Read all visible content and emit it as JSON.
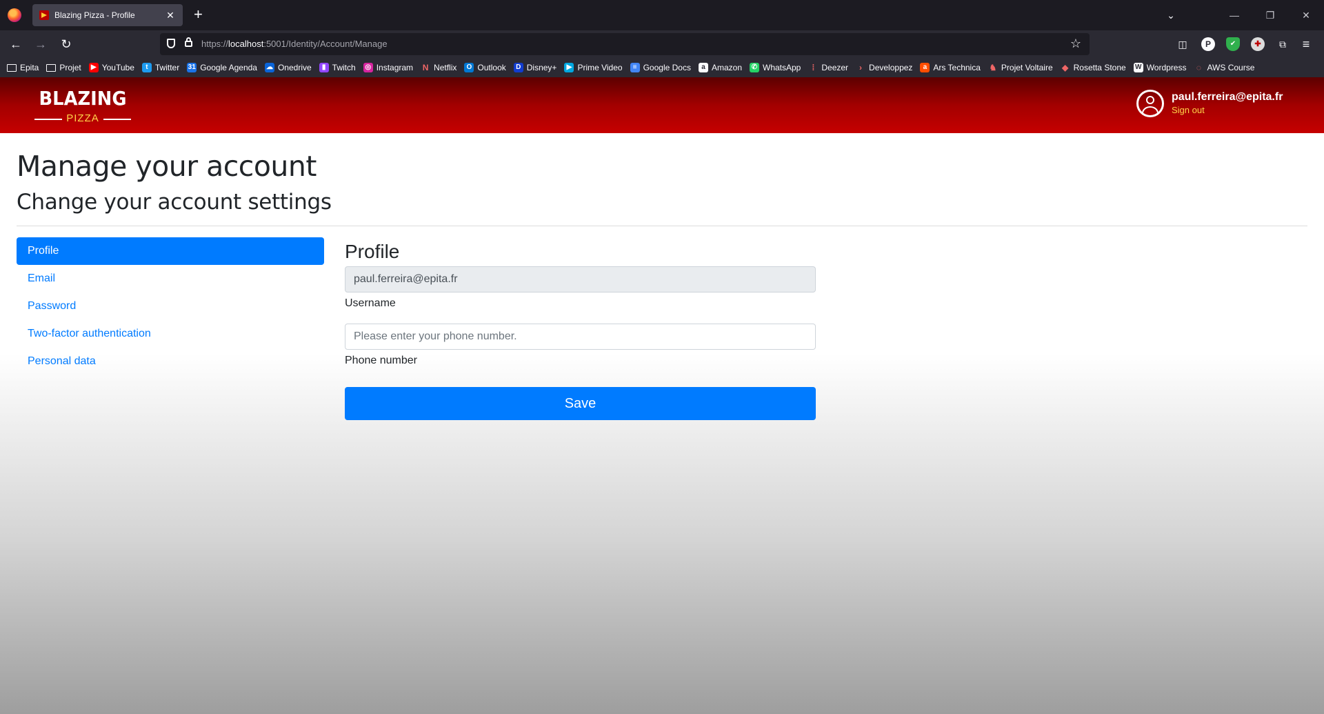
{
  "browser": {
    "tab": {
      "title": "Blazing Pizza - Profile",
      "close": "✕"
    },
    "new_tab": "+",
    "window_controls": {
      "tab_list": "⌄",
      "minimize": "—",
      "restore": "❐",
      "close": "✕"
    },
    "nav": {
      "back": "←",
      "forward": "→",
      "reload": "↻",
      "menu": "≡",
      "star": "☆"
    },
    "url": {
      "scheme": "https://",
      "host": "localhost",
      "rest": ":5001/Identity/Account/Manage"
    },
    "extensions": {
      "pocket": "◫",
      "p": "P",
      "shield": "✔",
      "globe": "✚",
      "puzzle": "⧉"
    },
    "bookmarks": [
      {
        "label": "Epita",
        "icon": "folder-icon"
      },
      {
        "label": "Projet",
        "icon": "folder-icon"
      },
      {
        "label": "YouTube",
        "icon": "youtube-icon",
        "color": "#ff0000",
        "glyph": "▶"
      },
      {
        "label": "Twitter",
        "icon": "twitter-icon",
        "color": "#1d9bf0",
        "glyph": "t"
      },
      {
        "label": "Google Agenda",
        "icon": "google-agenda-icon",
        "color": "#1a73e8",
        "glyph": "31"
      },
      {
        "label": "Onedrive",
        "icon": "onedrive-icon",
        "color": "#0a64d8",
        "glyph": "☁"
      },
      {
        "label": "Twitch",
        "icon": "twitch-icon",
        "color": "#9146ff",
        "glyph": "▮"
      },
      {
        "label": "Instagram",
        "icon": "instagram-icon",
        "color": "#d6249f",
        "glyph": "◎"
      },
      {
        "label": "Netflix",
        "icon": "netflix-icon",
        "color": "#2b2a33",
        "glyph": "N"
      },
      {
        "label": "Outlook",
        "icon": "outlook-icon",
        "color": "#0078d4",
        "glyph": "O"
      },
      {
        "label": "Disney+",
        "icon": "disney-icon",
        "color": "#113ccf",
        "glyph": "D"
      },
      {
        "label": "Prime Video",
        "icon": "prime-video-icon",
        "color": "#00a8e1",
        "glyph": "▶"
      },
      {
        "label": "Google Docs",
        "icon": "google-docs-icon",
        "color": "#4285f4",
        "glyph": "≡"
      },
      {
        "label": "Amazon",
        "icon": "amazon-icon",
        "color": "#fbfbfe",
        "glyph": "a"
      },
      {
        "label": "WhatsApp",
        "icon": "whatsapp-icon",
        "color": "#25d366",
        "glyph": "✆"
      },
      {
        "label": "Deezer",
        "icon": "deezer-icon",
        "color": "#2b2a33",
        "glyph": "⁞"
      },
      {
        "label": "Developpez",
        "icon": "developpez-icon",
        "color": "#2b2a33",
        "glyph": "›"
      },
      {
        "label": "Ars Technica",
        "icon": "ars-technica-icon",
        "color": "#ff4e00",
        "glyph": "a"
      },
      {
        "label": "Projet Voltaire",
        "icon": "projet-voltaire-icon",
        "color": "#2b2a33",
        "glyph": "♞"
      },
      {
        "label": "Rosetta Stone",
        "icon": "rosetta-stone-icon",
        "color": "#2b2a33",
        "glyph": "◆"
      },
      {
        "label": "Wordpress",
        "icon": "wordpress-icon",
        "color": "#fbfbfe",
        "glyph": "W"
      },
      {
        "label": "AWS Course",
        "icon": "aws-icon",
        "color": "#2b2a33",
        "glyph": "◌"
      }
    ]
  },
  "header": {
    "logo_main": "BLAZING",
    "logo_sub": "PIZZA",
    "user_email": "paul.ferreira@epita.fr",
    "sign_out": "Sign out"
  },
  "page": {
    "title": "Manage your account",
    "subtitle": "Change your account settings"
  },
  "sidebar": {
    "items": [
      {
        "label": "Profile",
        "active": true
      },
      {
        "label": "Email",
        "active": false
      },
      {
        "label": "Password",
        "active": false
      },
      {
        "label": "Two-factor authentication",
        "active": false
      },
      {
        "label": "Personal data",
        "active": false
      }
    ]
  },
  "profile": {
    "title": "Profile",
    "username_value": "paul.ferreira@epita.fr",
    "username_label": "Username",
    "phone_placeholder": "Please enter your phone number.",
    "phone_label": "Phone number",
    "save_label": "Save"
  },
  "colors": {
    "header_red": "#c60000",
    "accent_blue": "#007bff",
    "logo_yellow": "#ffd54a"
  }
}
